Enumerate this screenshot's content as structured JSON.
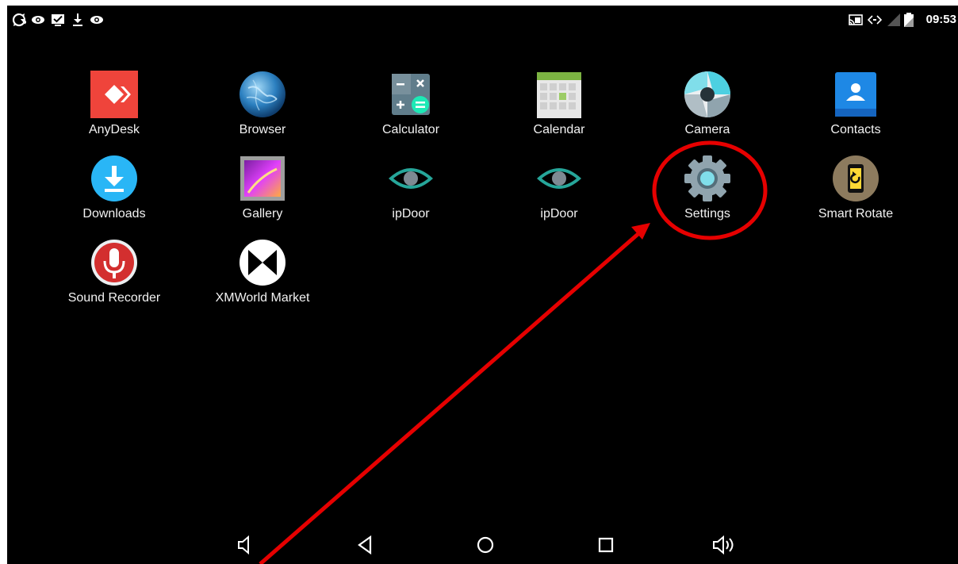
{
  "status_bar": {
    "time": "09:53",
    "left_icons": [
      "sync-icon",
      "eye-icon",
      "checkbox-notification-icon",
      "download-icon",
      "eye-icon"
    ],
    "right_icons": [
      "cast-icon",
      "data-arrows-icon",
      "no-signal-icon",
      "battery-icon"
    ]
  },
  "apps": [
    {
      "id": "anydesk",
      "label": "AnyDesk",
      "icon": "anydesk-icon"
    },
    {
      "id": "browser",
      "label": "Browser",
      "icon": "globe-icon"
    },
    {
      "id": "calculator",
      "label": "Calculator",
      "icon": "calculator-icon"
    },
    {
      "id": "calendar",
      "label": "Calendar",
      "icon": "calendar-icon"
    },
    {
      "id": "camera",
      "label": "Camera",
      "icon": "camera-shutter-icon"
    },
    {
      "id": "contacts",
      "label": "Contacts",
      "icon": "contacts-icon"
    },
    {
      "id": "downloads",
      "label": "Downloads",
      "icon": "download-icon"
    },
    {
      "id": "gallery",
      "label": "Gallery",
      "icon": "gallery-icon"
    },
    {
      "id": "ipdoor1",
      "label": "ipDoor",
      "icon": "eye-icon"
    },
    {
      "id": "ipdoor2",
      "label": "ipDoor",
      "icon": "eye-icon"
    },
    {
      "id": "settings",
      "label": "Settings",
      "icon": "gear-icon"
    },
    {
      "id": "smart-rotate",
      "label": "Smart Rotate",
      "icon": "rotate-icon"
    },
    {
      "id": "sound-recorder",
      "label": "Sound Recorder",
      "icon": "microphone-icon"
    },
    {
      "id": "xmworld",
      "label": "XMWorld Market",
      "icon": "xmworld-icon"
    }
  ],
  "nav_bar": [
    "volume-down-icon",
    "back-icon",
    "home-icon",
    "recents-icon",
    "volume-up-icon"
  ],
  "annotation": {
    "color": "#e60000",
    "target": "Settings"
  }
}
